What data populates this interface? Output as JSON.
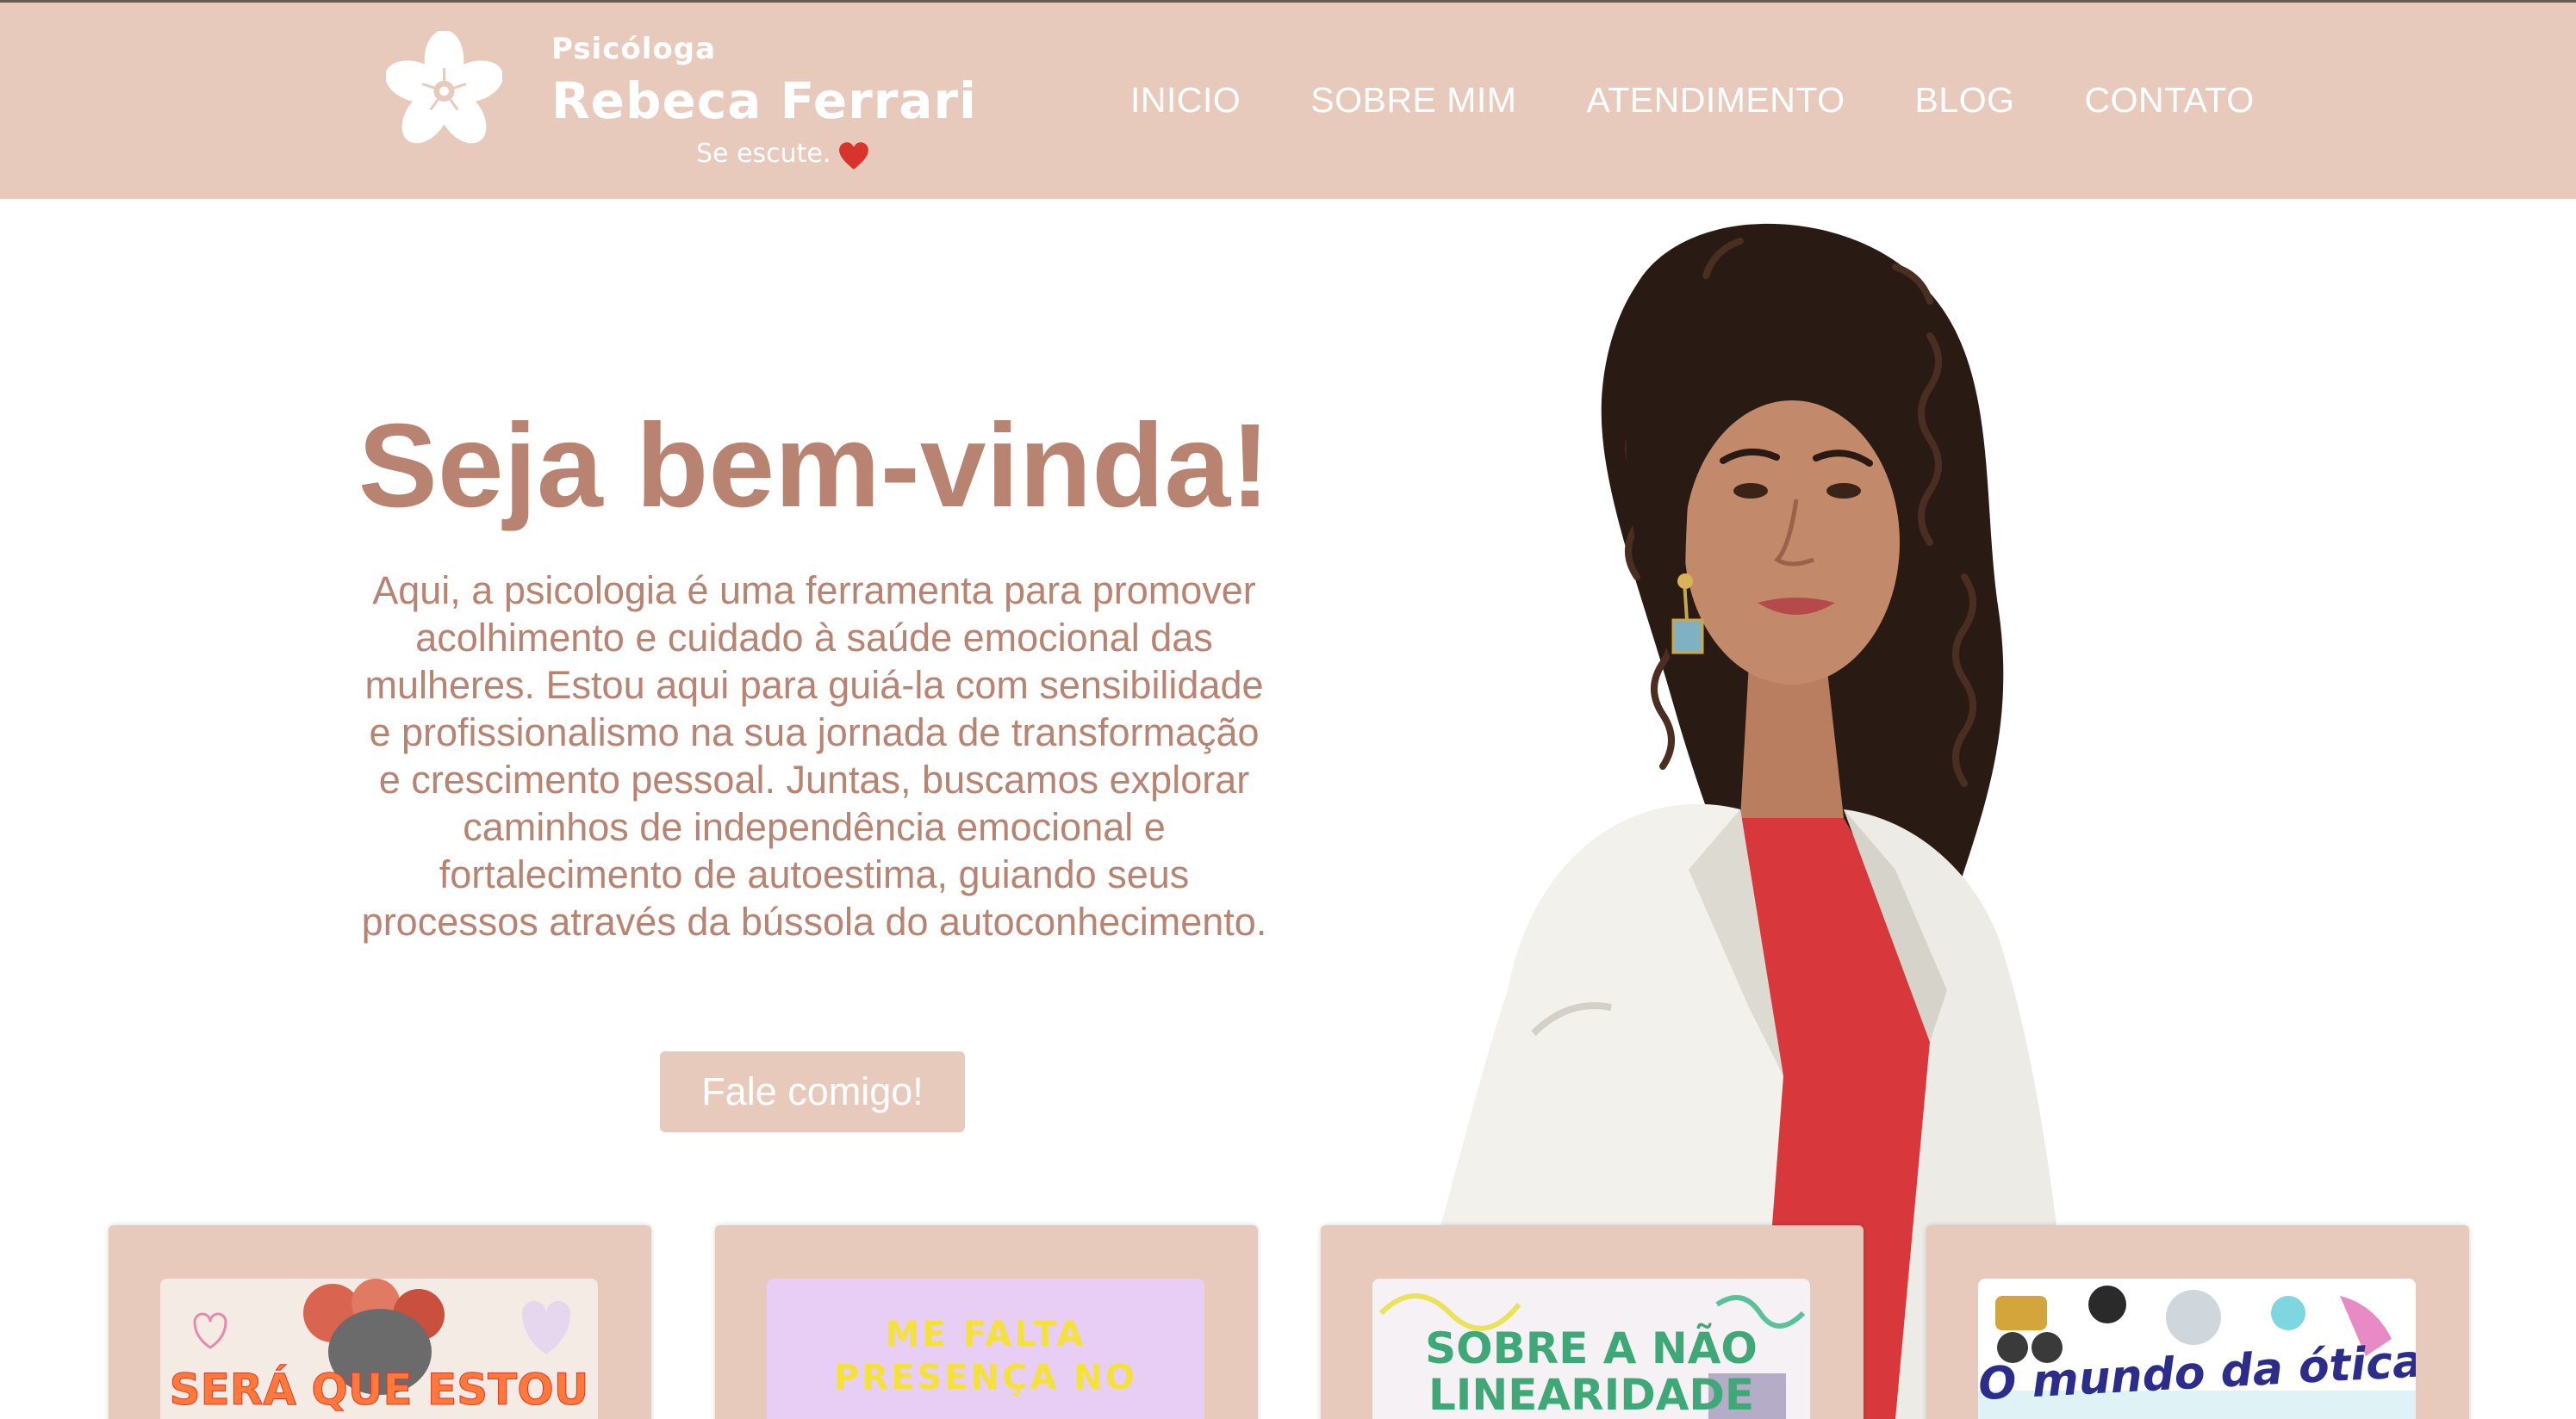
{
  "brand": {
    "small": "Psicóloga",
    "name": "Rebeca Ferrari",
    "tagline": "Se escute."
  },
  "nav": {
    "items": [
      {
        "label": "INICIO"
      },
      {
        "label": "SOBRE MIM"
      },
      {
        "label": "ATENDIMENTO"
      },
      {
        "label": "BLOG"
      },
      {
        "label": "CONTATO"
      }
    ]
  },
  "hero": {
    "title": "Seja bem-vinda!",
    "text": "Aqui, a psicologia é uma ferramenta para promover acolhimento e cuidado à saúde emocional das mulheres. Estou aqui para guiá-la com sensibilidade e profissionalismo na sua jornada de transformação e crescimento pessoal. Juntas, buscamos explorar caminhos de independência emocional e fortalecimento de autoestima, guiando seus processos através da bússola do autoconhecimento.",
    "cta": "Fale comigo!"
  },
  "posts": [
    {
      "title": "SERÁ QUE ESTOU"
    },
    {
      "title_line1": "ME FALTA",
      "title_line2": "PRESENÇA NO"
    },
    {
      "title_line1": "SOBRE A NÃO",
      "title_line2": "LINEARIDADE"
    },
    {
      "title": "O mundo da ótica"
    }
  ],
  "colors": {
    "header_bg": "#e8cabc",
    "accent_text": "#b88370",
    "heart": "#d9342b"
  }
}
